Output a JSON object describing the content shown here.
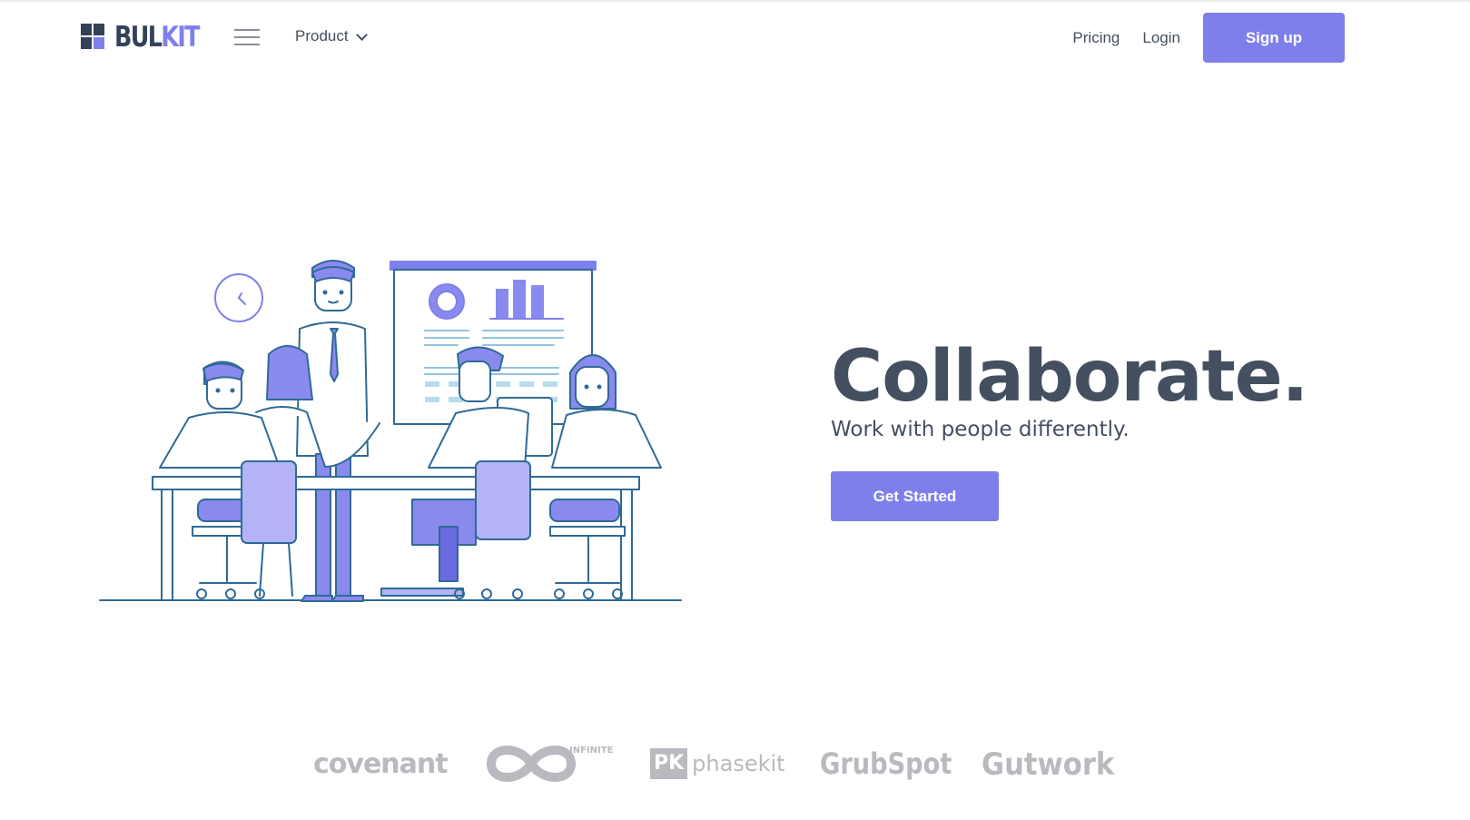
{
  "brand": {
    "text_dark": "BUL",
    "text_accent": "KIT"
  },
  "nav": {
    "menu_icon": "hamburger-icon",
    "product_label": "Product",
    "pricing_label": "Pricing",
    "login_label": "Login",
    "signup_label": "Sign up"
  },
  "hero": {
    "title": "Collaborate.",
    "subtitle": "Work with people differently.",
    "cta_label": "Get Started"
  },
  "clients": [
    {
      "name": "covenant"
    },
    {
      "name": "INFINITE"
    },
    {
      "badge": "PK",
      "name": "phasekit"
    },
    {
      "name": "GrubSpot"
    },
    {
      "name": "Gutwork"
    }
  ],
  "colors": {
    "accent": "#7f7fec",
    "dark": "#344258",
    "text": "#444f60",
    "illustration_stroke": "#2f6a96",
    "illustration_fill": "#eeeefc",
    "logo_gray": "#b9b9bf"
  }
}
